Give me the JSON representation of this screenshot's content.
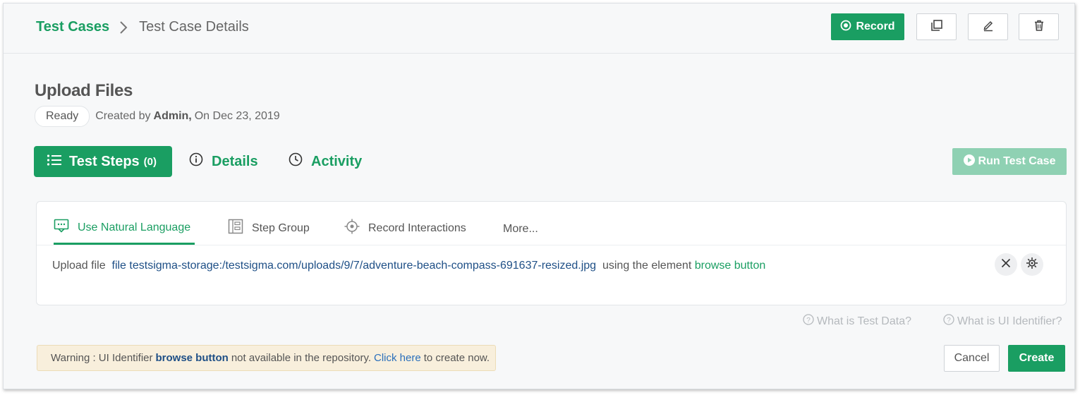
{
  "breadcrumb": {
    "root": "Test Cases",
    "current": "Test Case Details"
  },
  "toolbar": {
    "record_label": "Record",
    "icons": [
      "copy-icon",
      "edit-icon",
      "delete-icon"
    ]
  },
  "test_case": {
    "title": "Upload Files",
    "status": "Ready",
    "created_prefix": "Created by",
    "author": "Admin,",
    "created_on": "On Dec 23, 2019"
  },
  "tabs": {
    "steps_label": "Test Steps",
    "steps_count": "(0)",
    "details_label": "Details",
    "activity_label": "Activity"
  },
  "run_button": "Run Test Case",
  "editor": {
    "tabs": [
      "Use Natural Language",
      "Step Group",
      "Record Interactions",
      "More..."
    ],
    "step": {
      "prefix": "Upload file",
      "test_data": "file testsigma-storage:/testsigma.com/uploads/9/7/adventure-beach-compass-691637-resized.jpg",
      "middle": "using the element",
      "element": "browse button"
    }
  },
  "help_links": {
    "test_data": "What is Test Data?",
    "ui_identifier": "What is UI Identifier?"
  },
  "warning": {
    "prefix": "Warning : UI Identifier",
    "element": "browse button",
    "middle": "not available in the repository.",
    "link": "Click here",
    "suffix": "to create now."
  },
  "actions": {
    "cancel": "Cancel",
    "create": "Create"
  },
  "colors": {
    "primary": "#1a9e62",
    "primary_disabled": "#8fd1b3",
    "link": "#2a6fbb",
    "warning_bg": "#f8efdc"
  }
}
